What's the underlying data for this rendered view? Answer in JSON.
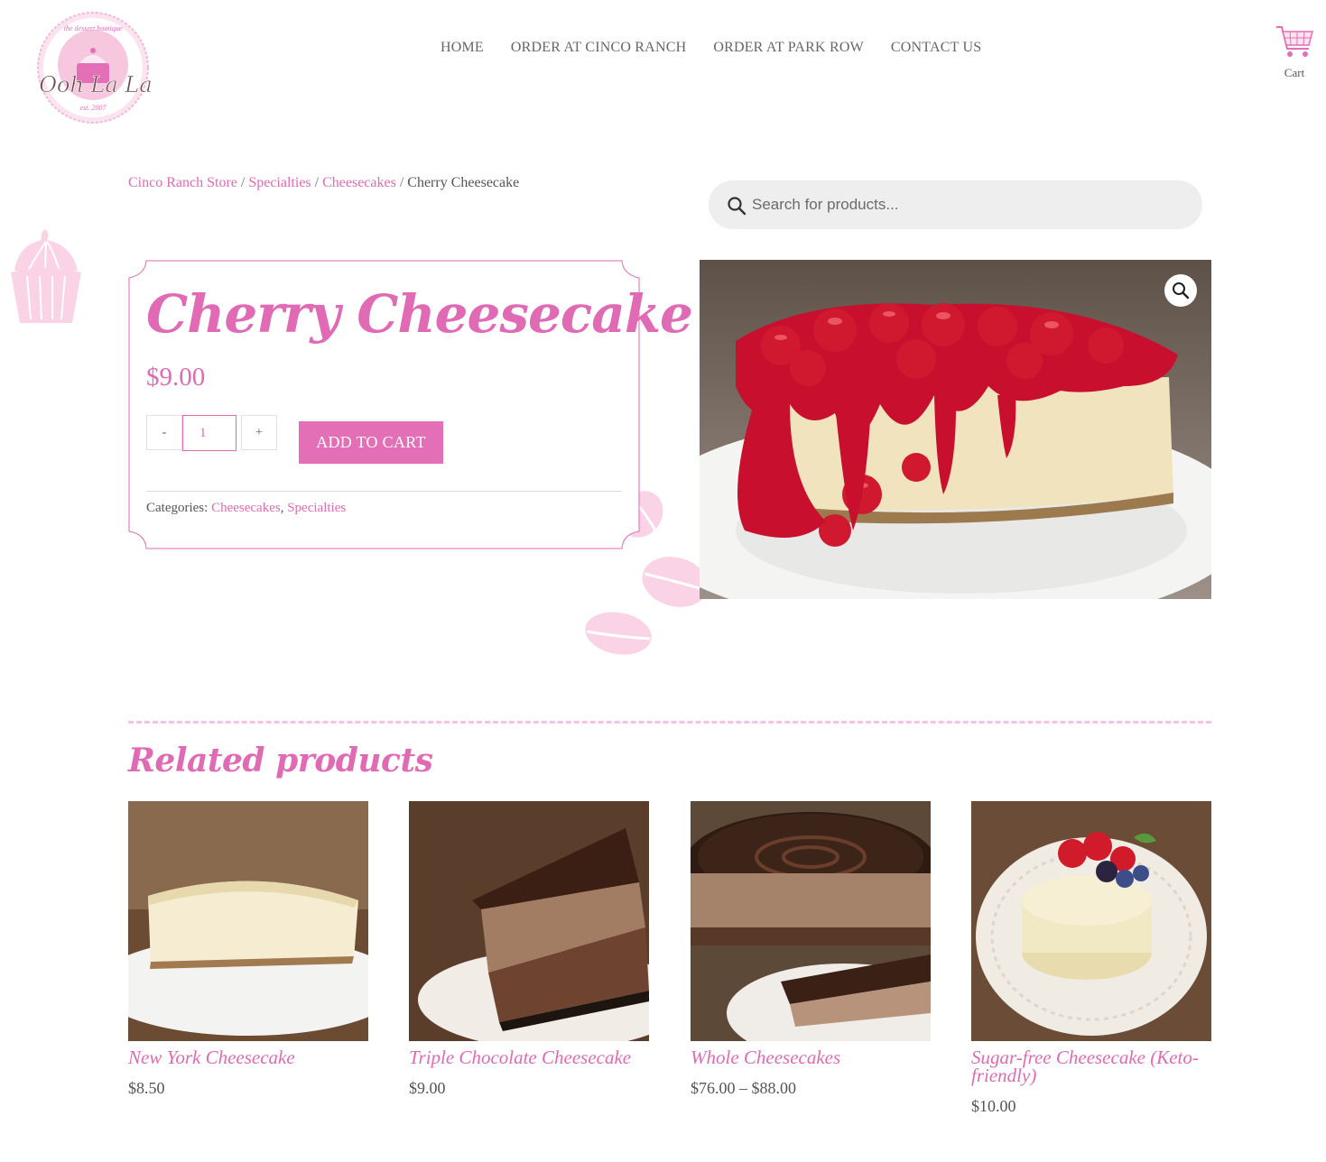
{
  "header": {
    "logo": {
      "text_top": "the dessert boutique",
      "text_main": "Ooh La La",
      "text_est": "est. 2007"
    },
    "nav": [
      "HOME",
      "ORDER AT CINCO RANCH",
      "ORDER AT PARK ROW",
      "CONTACT US"
    ],
    "cart_label": "Cart"
  },
  "breadcrumb": {
    "items": [
      "Cinco Ranch Store",
      "Specialties",
      "Cheesecakes"
    ],
    "separator": "/",
    "current": "Cherry Cheesecake"
  },
  "search": {
    "placeholder": "Search for products..."
  },
  "product": {
    "title": "Cherry Cheesecake",
    "price": "$9.00",
    "qty_minus": "-",
    "qty_value": "1",
    "qty_plus": "+",
    "add_to_cart": "ADD TO CART",
    "categories_label": "Categories:",
    "categories": [
      "Cheesecakes",
      "Specialties"
    ],
    "categories_sep": ","
  },
  "related": {
    "title": "Related products",
    "items": [
      {
        "name": "New York Cheesecake",
        "price": "$8.50"
      },
      {
        "name": "Triple Chocolate Cheesecake",
        "price": "$9.00"
      },
      {
        "name": "Whole Cheesecakes",
        "price": "$76.00 – $88.00"
      },
      {
        "name": "Sugar-free Cheesecake (Keto-friendly)",
        "price": "$10.00"
      }
    ]
  },
  "colors": {
    "accent": "#e06ab4",
    "button": "#e36fb6",
    "text": "#555555",
    "search_bg": "#eeeeee"
  },
  "icons": [
    "logo-badge",
    "cart-icon",
    "search-icon",
    "zoom-icon",
    "cupcake-decoration",
    "macaron-decoration"
  ]
}
